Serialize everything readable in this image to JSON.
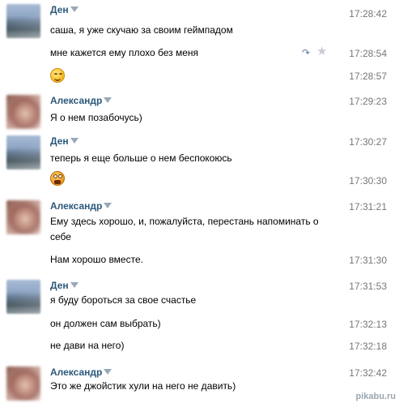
{
  "messages": [
    {
      "sender": "Ден",
      "lines": [
        {
          "text": "саша, я уже скучаю за своим геймпадом",
          "time": "17:28:42"
        },
        {
          "text": "мне кажется ему плохо без меня",
          "time": "17:28:54"
        },
        {
          "emoji": "smile-emoji",
          "time": "17:28:57"
        }
      ]
    },
    {
      "sender": "Александр",
      "lines": [
        {
          "text": "Я о нем позабочусь)",
          "time": "17:29:23"
        }
      ]
    },
    {
      "sender": "Ден",
      "lines": [
        {
          "text": "теперь я еще больше о нем беспокоюсь",
          "time": "17:30:27"
        },
        {
          "emoji": "shocked-emoji",
          "time": "17:30:30"
        }
      ]
    },
    {
      "sender": "Александр",
      "lines": [
        {
          "text": "Ему здесь хорошо, и, пожалуйста, перестань напоминать о себе",
          "time": "17:31:21"
        },
        {
          "text": "Нам хорошо вместе.",
          "time": "17:31:30"
        }
      ]
    },
    {
      "sender": "Ден",
      "lines": [
        {
          "text": "я буду бороться за свое счастье",
          "time": "17:31:53"
        },
        {
          "text": "он должен сам выбрать)",
          "time": "17:32:13"
        },
        {
          "text": "не дави на него)",
          "time": "17:32:18"
        }
      ]
    },
    {
      "sender": "Александр",
      "lines": [
        {
          "text": "Это же джойстик хули на него не давить)",
          "time": "17:32:42"
        }
      ]
    }
  ],
  "icons": {
    "forward": "forward-icon",
    "star": "star-icon"
  },
  "colors": {
    "name": "#2b587a",
    "time": "#777777",
    "text": "#000000"
  },
  "watermark": "pikabu.ru"
}
